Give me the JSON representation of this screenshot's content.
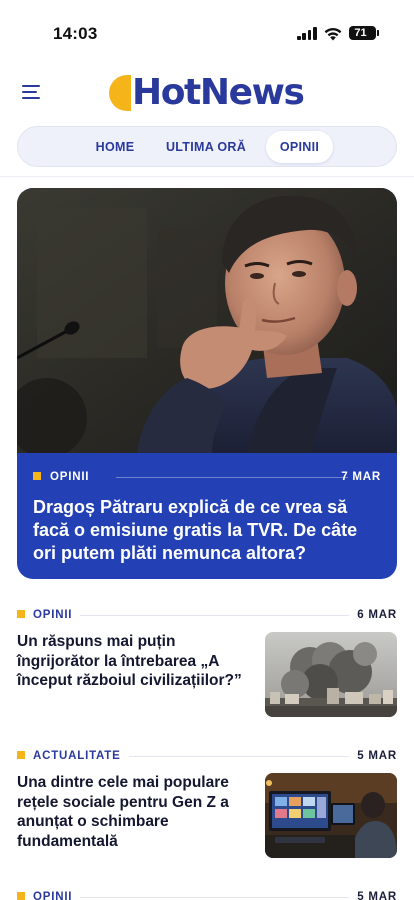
{
  "status_bar": {
    "time": "14:03",
    "battery": "71"
  },
  "header": {
    "logo_text": "HotNews",
    "menu_icon": "hamburger-menu-icon"
  },
  "nav": {
    "tabs": [
      {
        "label": "HOME"
      },
      {
        "label": "ULTIMA ORĂ"
      },
      {
        "label": "OPINII",
        "active": true
      }
    ]
  },
  "hero": {
    "category": "OPINII",
    "date": "7 MAR",
    "title": "Dragoș Pătraru explică de ce vrea să facă o emisiune gratis la TVR. De câte ori putem plăti nemunca altora?"
  },
  "articles": [
    {
      "category": "OPINII",
      "date": "6 MAR",
      "title": "Un răspuns mai puțin îngrijorător la întrebarea „A început războiul civilizațiilor?”"
    },
    {
      "category": "ACTUALITATE",
      "date": "5 MAR",
      "title": "Una dintre cele mai populare rețele sociale pentru Gen Z a anunțat o schimbare fundamentală"
    },
    {
      "category": "OPINII",
      "date": "5 MAR"
    }
  ],
  "colors": {
    "brand_blue": "#2a3a9c",
    "hero_blue": "#2341b5",
    "accent_yellow": "#f5b41a"
  }
}
